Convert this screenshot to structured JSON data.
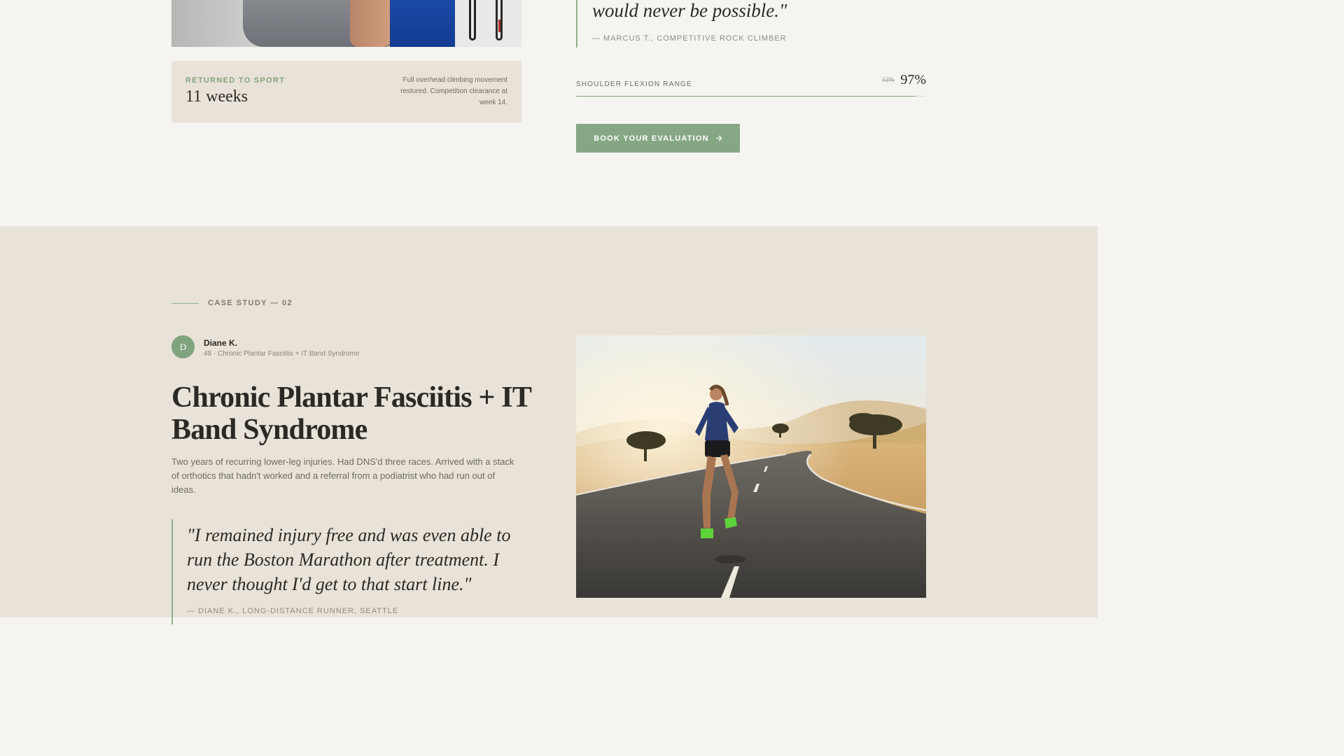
{
  "previous_case": {
    "quote_tail": "would never be possible.\"",
    "quote_author": "— MARCUS T., COMPETITIVE ROCK CLIMBER",
    "result": {
      "label": "RETURNED TO SPORT",
      "value": "11 weeks",
      "note": "Full overhead climbing movement restored. Competition clearance at week 14."
    },
    "metric": {
      "label": "SHOULDER FLEXION RANGE",
      "before": "12%",
      "after": "97%",
      "progress_percent": 97
    },
    "cta": {
      "label": "BOOK YOUR EVALUATION",
      "icon": "arrow-right-icon"
    }
  },
  "case_study": {
    "eyebrow": "CASE STUDY — 02",
    "patient": {
      "initial": "D",
      "name": "Diane K.",
      "meta": "48 · Chronic Plantar Fasciitis + IT Band Syndrome"
    },
    "title": "Chronic Plantar Fasciitis + IT Band Syndrome",
    "description": "Two years of recurring lower-leg injuries. Had DNS'd three races. Arrived with a stack of orthotics that hadn't worked and a referral from a podiatrist who had run out of ideas.",
    "quote": "\"I remained injury free and was even able to run the Boston Marathon after treatment. I never thought I'd get to that start line.\"",
    "quote_author": "— DIANE K., LONG-DISTANCE RUNNER, SEATTLE"
  },
  "colors": {
    "accent_green": "#86a784",
    "page_bg": "#f6f4f0",
    "section_bg": "#e8e2d8",
    "card_bg": "#e9e2d8"
  }
}
